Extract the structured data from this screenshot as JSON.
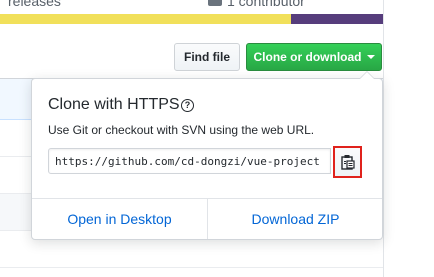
{
  "stats": {
    "releases_label": "releases",
    "contributors_label": "1 contributor"
  },
  "language_bar": [
    {
      "color": "#f1e05a",
      "fraction": 0.76
    },
    {
      "color": "#563d7c",
      "fraction": 0.24
    }
  ],
  "toolbar": {
    "find_file_label": "Find file",
    "clone_label": "Clone or download"
  },
  "clone_popover": {
    "title": "Clone with HTTPS",
    "help_glyph": "?",
    "description": "Use Git or checkout with SVN using the web URL.",
    "url_value": "https://github.com/cd-dongzi/vue-project",
    "copy_icon": "clipboard-icon",
    "highlight_color": "#e0221c",
    "open_desktop_label": "Open in Desktop",
    "download_zip_label": "Download ZIP"
  },
  "colors": {
    "clone_button": "#28a745",
    "link": "#0366d6"
  }
}
